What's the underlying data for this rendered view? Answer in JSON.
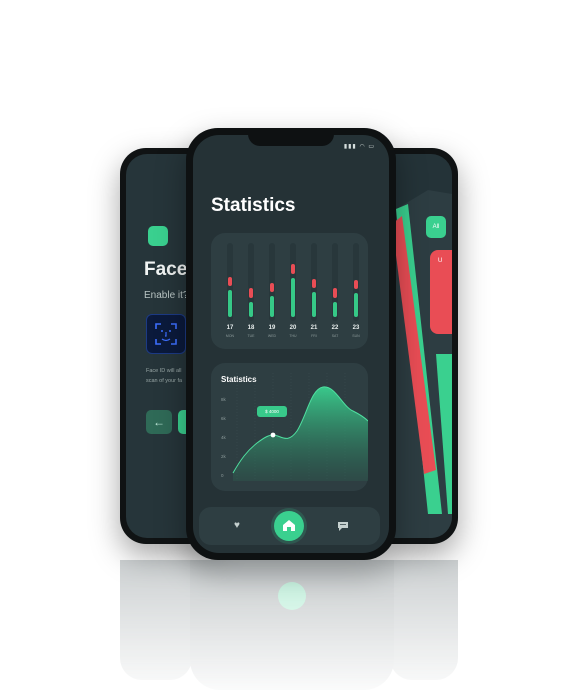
{
  "face_id_screen": {
    "title": "Face ID",
    "title_visible": "Face",
    "subtitle": "Enable it?",
    "description_line1": "Face ID will all",
    "description_line2": "scan of your fa",
    "back_icon": "arrow-left-icon"
  },
  "filter_screen": {
    "chip_label": "All",
    "item_label": "U"
  },
  "statistics_screen": {
    "page_title": "Statistics",
    "weekly_chart": {
      "days": [
        {
          "num": "17",
          "name": "MON",
          "green": 0.55,
          "red": 0.18
        },
        {
          "num": "18",
          "name": "TUE",
          "green": 0.32,
          "red": 0.2
        },
        {
          "num": "19",
          "name": "WED",
          "green": 0.44,
          "red": 0.18
        },
        {
          "num": "20",
          "name": "THU",
          "green": 0.8,
          "red": 0.2
        },
        {
          "num": "21",
          "name": "FRI",
          "green": 0.52,
          "red": 0.18
        },
        {
          "num": "22",
          "name": "SAT",
          "green": 0.3,
          "red": 0.2
        },
        {
          "num": "23",
          "name": "SUN",
          "green": 0.5,
          "red": 0.18
        }
      ]
    },
    "stats_card": {
      "title": "Statistics",
      "tooltip": "$ 4000",
      "y_ticks": [
        "8k",
        "6k",
        "4k",
        "2k",
        "0"
      ]
    },
    "tabbar": {
      "left_icon": "heart-icon",
      "center_icon": "home-icon",
      "right_icon": "chat-icon"
    }
  },
  "colors": {
    "accent_green": "#3ad08f",
    "alert_red": "#e94d55",
    "screen_bg": "#253236",
    "card_bg": "#2e3e42"
  }
}
